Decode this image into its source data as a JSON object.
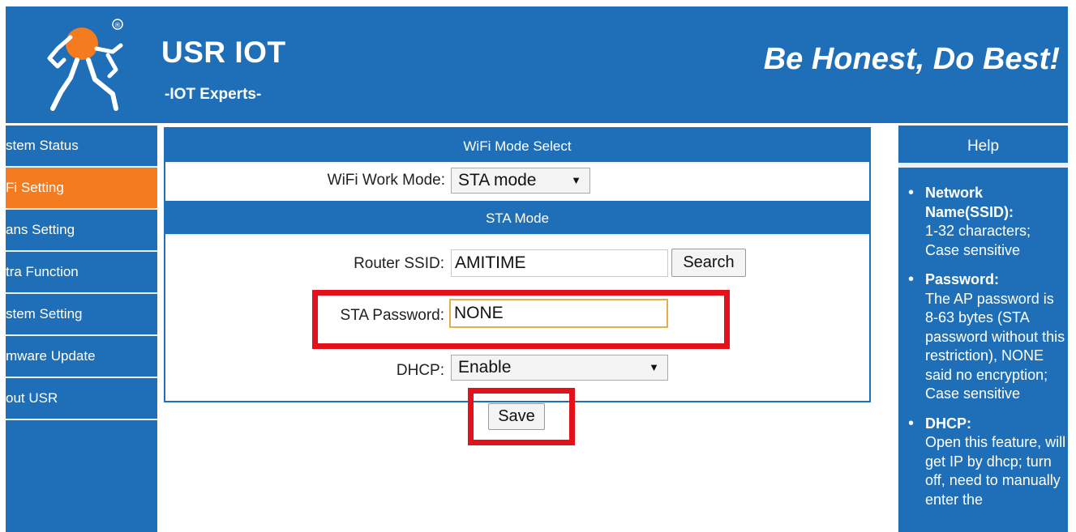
{
  "header": {
    "brand_title": "USR IOT",
    "brand_subtitle": "-IOT Experts-",
    "slogan": "Be Honest, Do Best!",
    "logo_icon": "running-person-logo-icon",
    "registered_mark": "®"
  },
  "sidebar": {
    "items": [
      {
        "label": "stem Status",
        "active": false
      },
      {
        "label": "Fi Setting",
        "active": true
      },
      {
        "label": "ans Setting",
        "active": false
      },
      {
        "label": "tra Function",
        "active": false
      },
      {
        "label": "stem Setting",
        "active": false
      },
      {
        "label": "mware Update",
        "active": false
      },
      {
        "label": "out USR",
        "active": false
      }
    ]
  },
  "main": {
    "mode_select_title": "WiFi Mode Select",
    "work_mode_label": "WiFi Work Mode:",
    "work_mode_value": "STA mode",
    "sta_title": "STA Mode",
    "ssid_label": "Router SSID:",
    "ssid_value": "AMITIME",
    "search_label": "Search",
    "password_label": "STA Password:",
    "password_value": "NONE",
    "dhcp_label": "DHCP:",
    "dhcp_value": "Enable",
    "save_label": "Save",
    "arrow_glyph": "▼"
  },
  "help": {
    "title": "Help",
    "items": [
      {
        "term": "Network Name(SSID):",
        "desc": "1-32 characters; Case sensitive"
      },
      {
        "term": "Password:",
        "desc": "The AP password is 8-63 bytes (STA password without this restriction), NONE said no encryption; Case sensitive"
      },
      {
        "term": "DHCP:",
        "desc": "Open this feature, will get IP by dhcp; turn off, need to manually enter the"
      }
    ]
  },
  "colors": {
    "primary_blue": "#1f6fb8",
    "active_orange": "#f47b1f",
    "highlight_red": "#e3121a"
  }
}
